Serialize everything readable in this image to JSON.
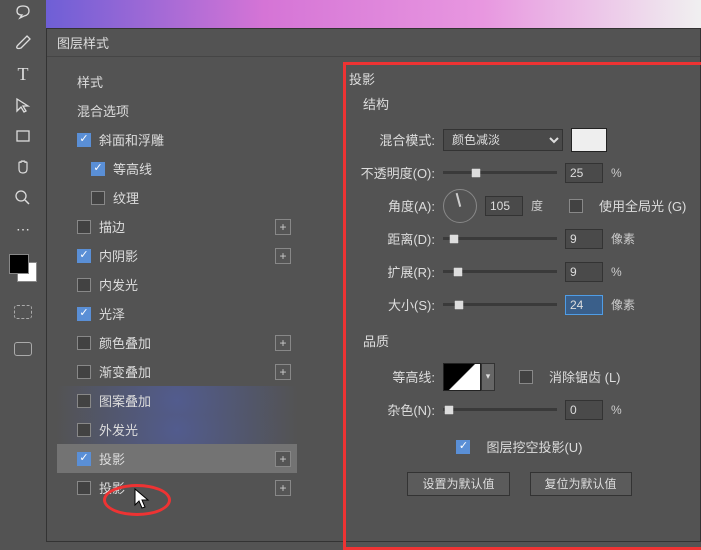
{
  "dialog_title": "图层样式",
  "styles": {
    "header": "样式",
    "blend_options": "混合选项",
    "bevel": "斜面和浮雕",
    "contour": "等高线",
    "texture": "纹理",
    "stroke": "描边",
    "inner_shadow": "内阴影",
    "inner_glow": "内发光",
    "satin": "光泽",
    "color_overlay": "颜色叠加",
    "gradient_overlay": "渐变叠加",
    "pattern_overlay": "图案叠加",
    "outer_glow": "外发光",
    "drop_shadow_sel": "投影",
    "drop_shadow2": "投影"
  },
  "right": {
    "title": "投影",
    "structure": "结构",
    "blend_mode_lbl": "混合模式:",
    "blend_mode_val": "颜色减淡",
    "opacity_lbl": "不透明度(O):",
    "opacity_val": "25",
    "pct": "%",
    "angle_lbl": "角度(A):",
    "angle_val": "105",
    "angle_unit": "度",
    "global_light": "使用全局光 (G)",
    "distance_lbl": "距离(D):",
    "distance_val": "9",
    "px": "像素",
    "spread_lbl": "扩展(R):",
    "spread_val": "9",
    "size_lbl": "大小(S):",
    "size_val": "24",
    "quality": "品质",
    "contour_lbl": "等高线:",
    "antialias": "消除锯齿 (L)",
    "noise_lbl": "杂色(N):",
    "noise_val": "0",
    "knockout": "图层挖空投影(U)",
    "make_default": "设置为默认值",
    "reset_default": "复位为默认值"
  },
  "plus": "+"
}
